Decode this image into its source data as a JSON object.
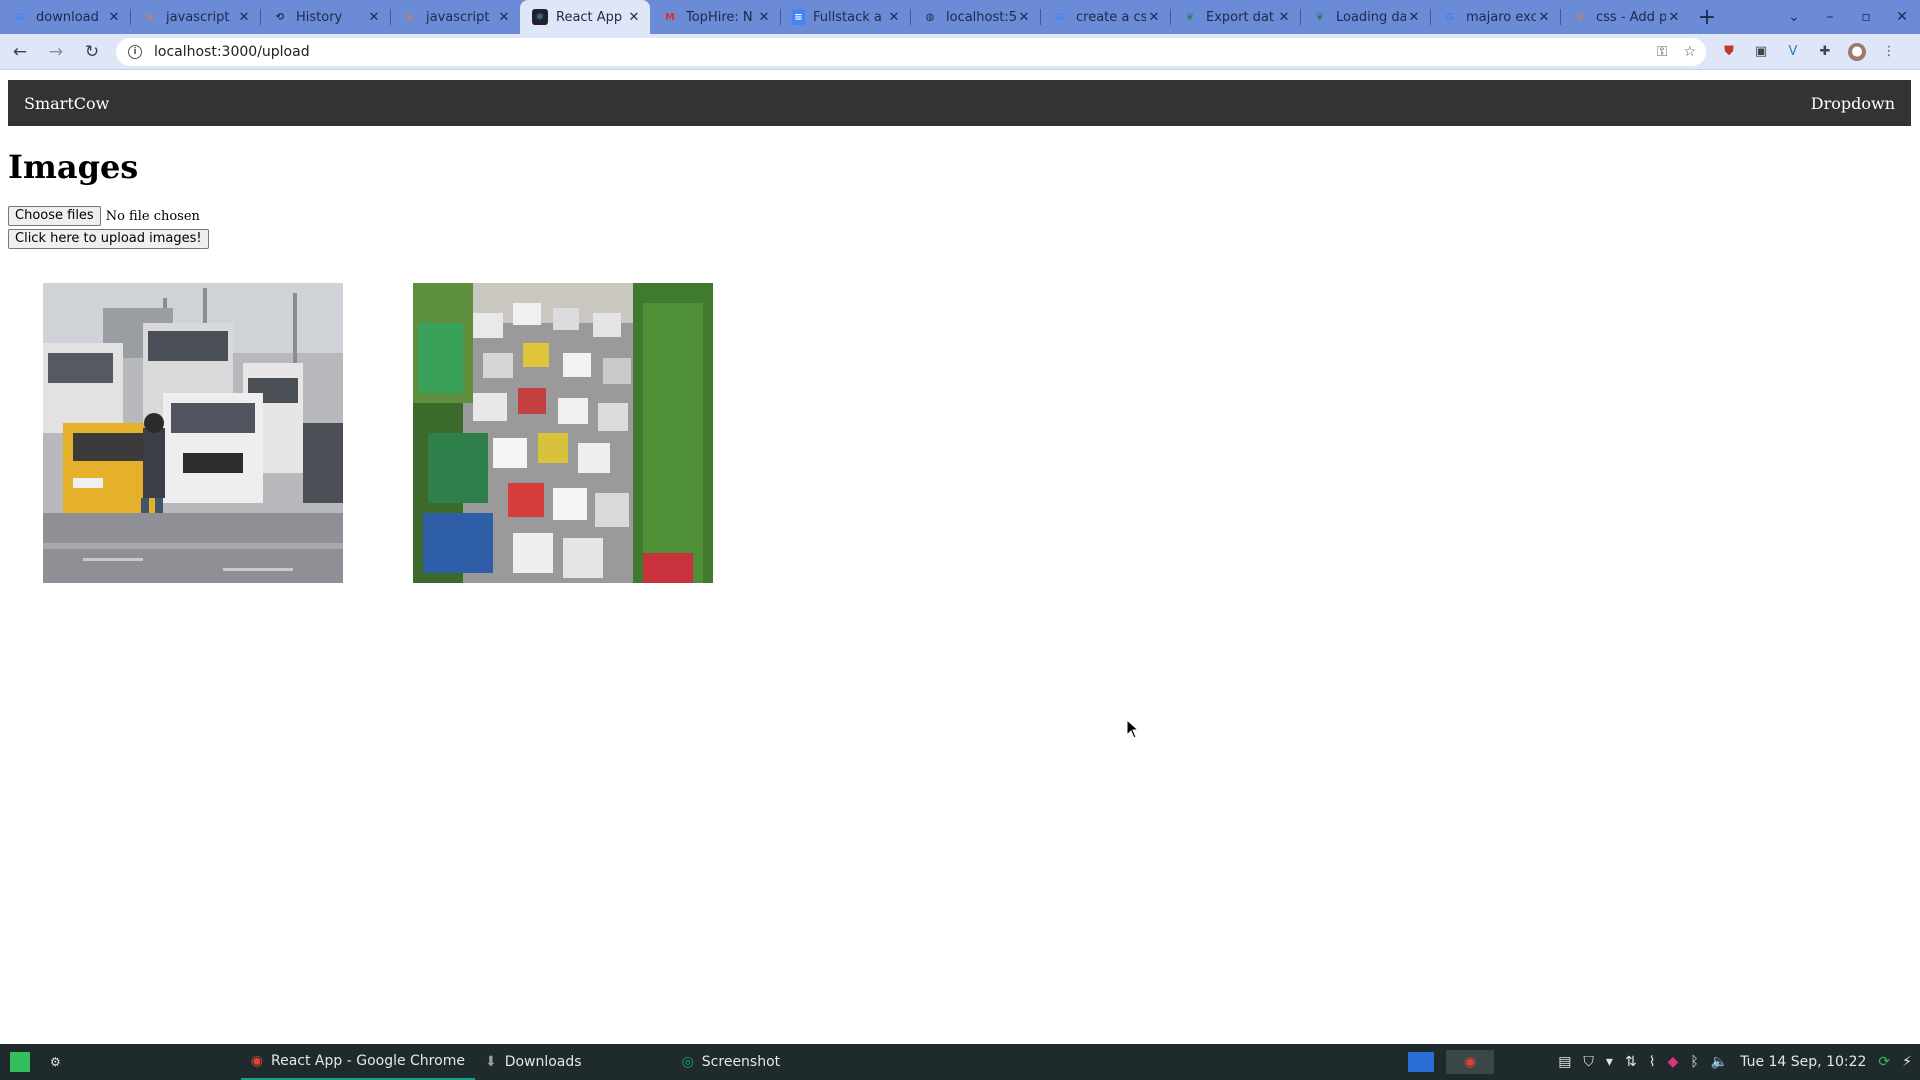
{
  "browser": {
    "tabs": [
      {
        "title": "download ",
        "icon": "google-icon",
        "active": false
      },
      {
        "title": "javascript ",
        "icon": "stackoverflow-icon",
        "active": false
      },
      {
        "title": "History",
        "icon": "history-icon",
        "active": false
      },
      {
        "title": "javascript ",
        "icon": "stackoverflow-icon",
        "active": false
      },
      {
        "title": "React App",
        "icon": "react-icon",
        "active": true
      },
      {
        "title": "TopHire: N",
        "icon": "gmail-icon",
        "active": false
      },
      {
        "title": "Fullstack a",
        "icon": "docs-icon",
        "active": false
      },
      {
        "title": "localhost:5",
        "icon": "globe-icon",
        "active": false
      },
      {
        "title": "create a cs",
        "icon": "google-icon",
        "active": false
      },
      {
        "title": "Export dat",
        "icon": "bird-icon",
        "active": false
      },
      {
        "title": "Loading da",
        "icon": "bird-icon",
        "active": false
      },
      {
        "title": "majaro exc",
        "icon": "google-icon",
        "active": false
      },
      {
        "title": "css - Add p",
        "icon": "stackoverflow-icon",
        "active": false
      }
    ],
    "url": "localhost:3000/upload"
  },
  "page": {
    "brand": "SmartCow",
    "dropdown": "Dropdown",
    "heading": "Images",
    "choose_files": "Choose files",
    "file_status": "No file chosen",
    "upload_button": "Click here to upload images!",
    "images": [
      {
        "name": "traffic-rain-photo"
      },
      {
        "name": "traffic-jam-photo"
      }
    ]
  },
  "taskbar": {
    "items": [
      {
        "label": "React App - Google Chrome",
        "icon": "chrome-icon",
        "active": true
      },
      {
        "label": "Downloads",
        "icon": "download-icon",
        "active": false
      },
      {
        "label": "Screenshot",
        "icon": "screenshot-icon",
        "active": false
      }
    ],
    "clock": "Tue 14 Sep, 10:22"
  }
}
